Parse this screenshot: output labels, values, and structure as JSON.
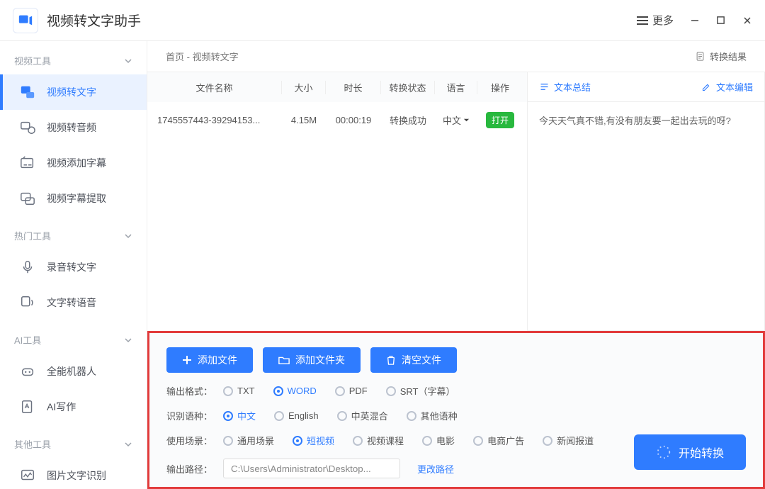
{
  "app": {
    "title": "视频转文字助手",
    "more_label": "更多"
  },
  "sidebar": {
    "groups": [
      {
        "title": "视频工具",
        "items": [
          "视频转文字",
          "视频转音频",
          "视频添加字幕",
          "视频字幕提取"
        ]
      },
      {
        "title": "热门工具",
        "items": [
          "录音转文字",
          "文字转语音"
        ]
      },
      {
        "title": "AI工具",
        "items": [
          "全能机器人",
          "AI写作"
        ]
      },
      {
        "title": "其他工具",
        "items": [
          "图片文字识别"
        ]
      }
    ],
    "active_index": [
      0,
      0
    ]
  },
  "breadcrumb": {
    "home": "首页",
    "sep": " - ",
    "current": "视频转文字",
    "result_label": "转换结果"
  },
  "table": {
    "headers": {
      "name": "文件名称",
      "size": "大小",
      "duration": "时长",
      "status": "转换状态",
      "lang": "语言",
      "op": "操作"
    },
    "rows": [
      {
        "name": "1745557443-39294153...",
        "size": "4.15M",
        "duration": "00:00:19",
        "status": "转换成功",
        "lang": "中文",
        "op": "打开"
      }
    ]
  },
  "panel": {
    "summary_label": "文本总结",
    "edit_label": "文本编辑",
    "text": "今天天气真不错,有没有朋友要一起出去玩的呀?"
  },
  "bottom": {
    "buttons": {
      "add_file": "添加文件",
      "add_folder": "添加文件夹",
      "clear": "清空文件"
    },
    "format": {
      "label": "输出格式：",
      "options": [
        "TXT",
        "WORD",
        "PDF",
        "SRT（字幕）"
      ],
      "selected": "WORD"
    },
    "lang": {
      "label": "识别语种：",
      "options": [
        "中文",
        "English",
        "中英混合",
        "其他语种"
      ],
      "selected": "中文"
    },
    "scene": {
      "label": "使用场景：",
      "options": [
        "通用场景",
        "短视频",
        "视频课程",
        "电影",
        "电商广告",
        "新闻报道"
      ],
      "selected": "短视频"
    },
    "path": {
      "label": "输出路径：",
      "value": "C:\\Users\\Administrator\\Desktop...",
      "change": "更改路径"
    },
    "start": "开始转换"
  }
}
